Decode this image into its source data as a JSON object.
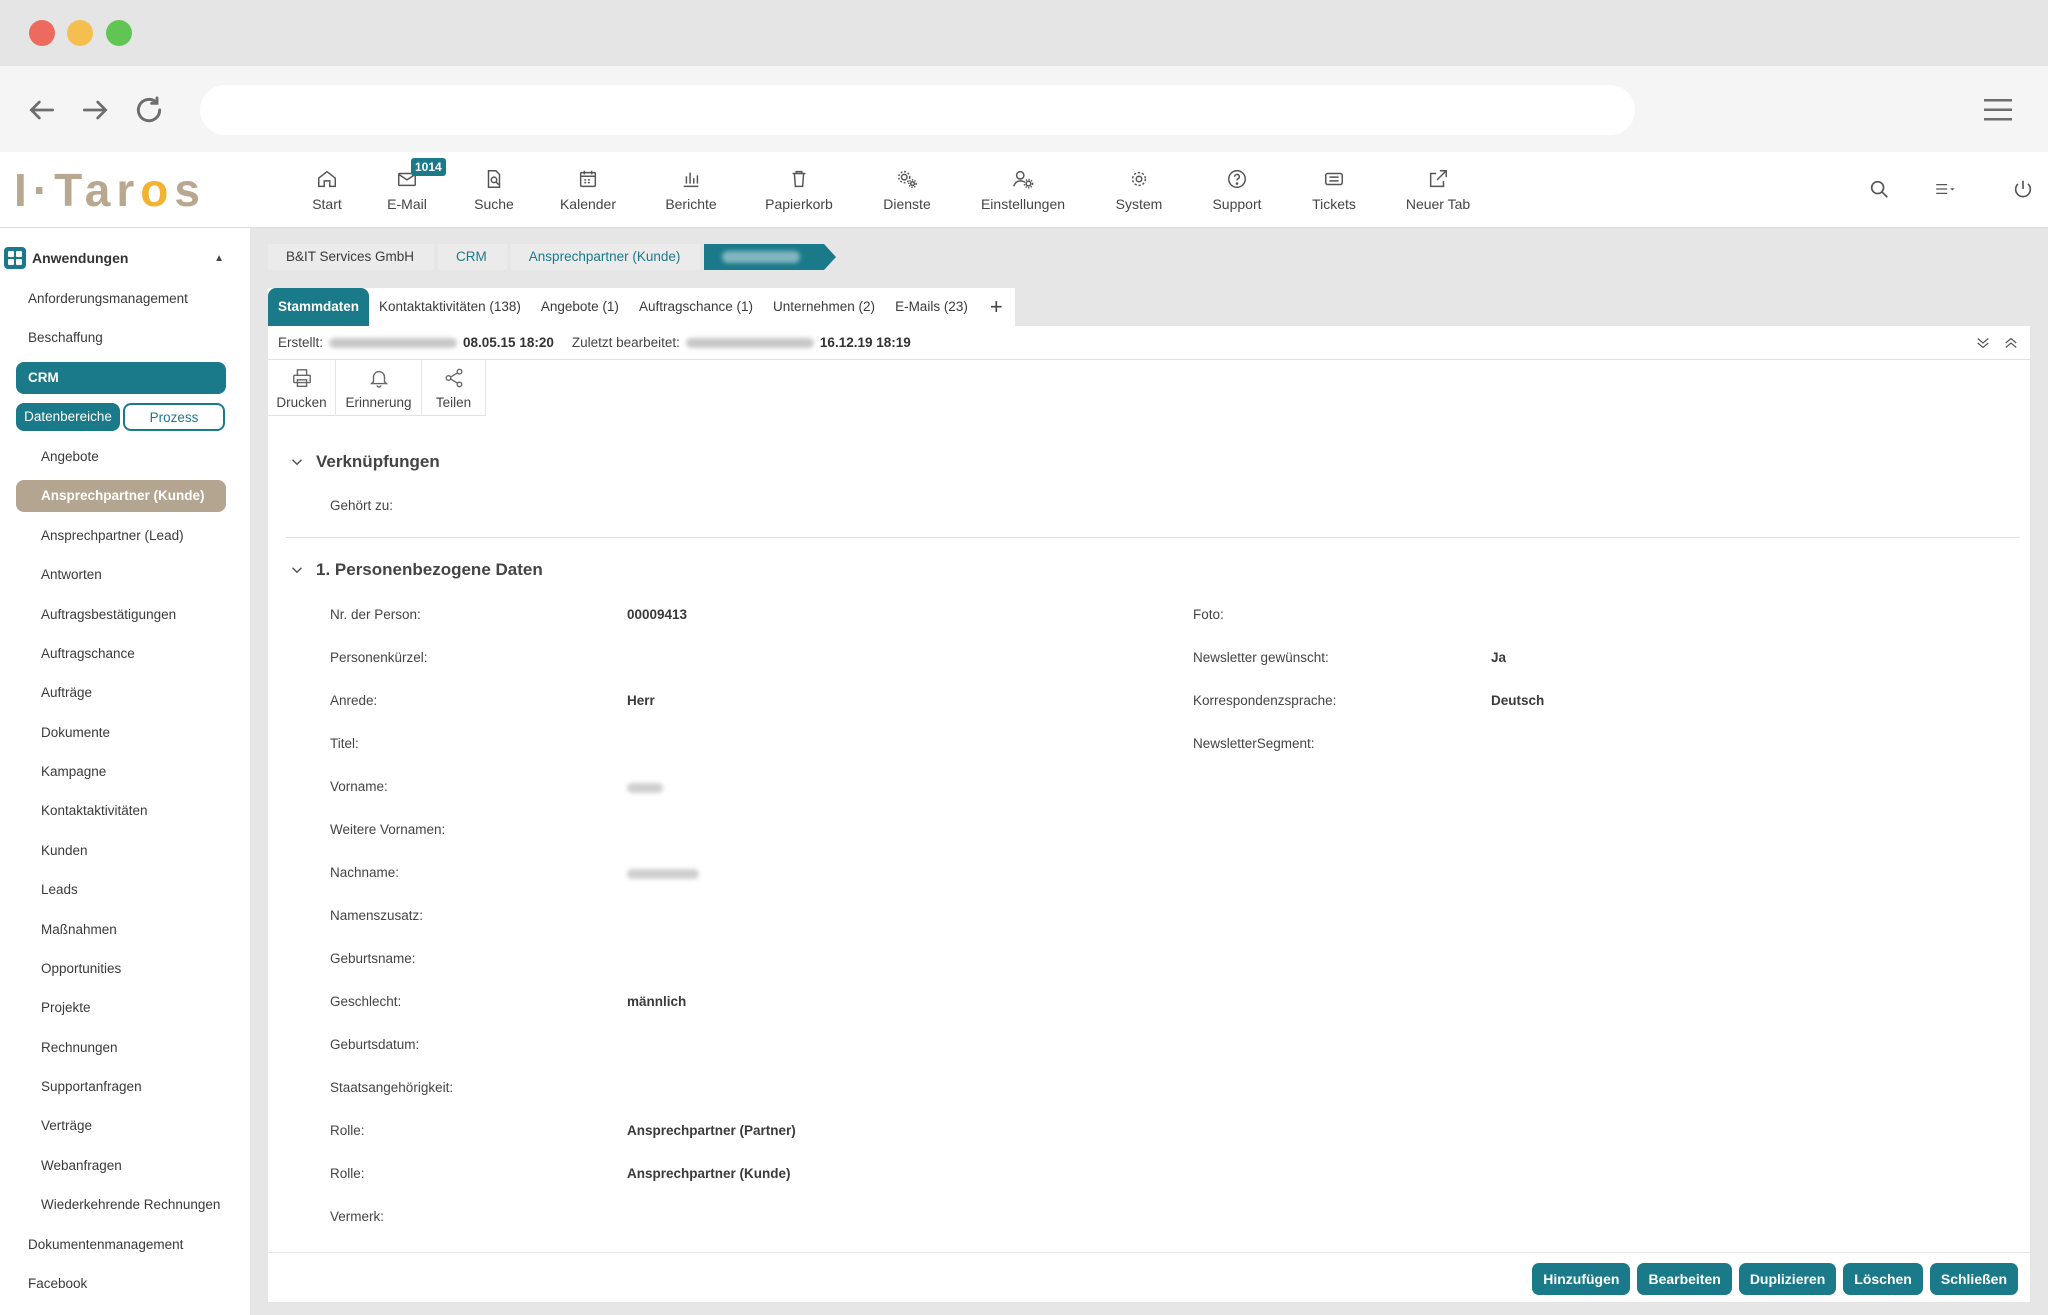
{
  "browser": {
    "icons": {
      "back": "arrow-left-icon",
      "forward": "arrow-right-icon",
      "reload": "reload-icon",
      "menu": "hamburger-icon"
    }
  },
  "app": {
    "logo_text_1": "I·Tar",
    "logo_text_2": "o",
    "logo_text_3": "s",
    "accent_color": "#1b7a8a",
    "toolbar": [
      {
        "label": "Start",
        "icon": "home-icon"
      },
      {
        "label": "E-Mail",
        "icon": "mail-icon",
        "badge": "1014"
      },
      {
        "label": "Suche",
        "icon": "search-doc-icon"
      },
      {
        "label": "Kalender",
        "icon": "calendar-icon"
      },
      {
        "label": "Berichte",
        "icon": "bar-chart-icon"
      },
      {
        "label": "Papierkorb",
        "icon": "trash-icon"
      },
      {
        "label": "Dienste",
        "icon": "gears-icon"
      },
      {
        "label": "Einstellungen",
        "icon": "user-gear-icon"
      },
      {
        "label": "System",
        "icon": "gear-icon"
      },
      {
        "label": "Support",
        "icon": "question-icon"
      },
      {
        "label": "Tickets",
        "icon": "ticket-icon"
      },
      {
        "label": "Neuer Tab",
        "icon": "external-link-icon"
      }
    ]
  },
  "sidebar": {
    "header": "Anwendungen",
    "items_top": [
      "Anforderungsmanagement",
      "Beschaffung"
    ],
    "crm": "CRM",
    "seg_on": "Datenbereiche",
    "seg_off": "Prozess",
    "sub_items": [
      "Angebote",
      "Ansprechpartner (Kunde)",
      "Ansprechpartner (Lead)",
      "Antworten",
      "Auftragsbestätigungen",
      "Auftragschance",
      "Aufträge",
      "Dokumente",
      "Kampagne",
      "Kontaktaktivitäten",
      "Kunden",
      "Leads",
      "Maßnahmen",
      "Opportunities",
      "Projekte",
      "Rechnungen",
      "Supportanfragen",
      "Verträge",
      "Webanfragen",
      "Wiederkehrende Rechnungen"
    ],
    "items_bottom": [
      "Dokumentenmanagement",
      "Facebook"
    ]
  },
  "breadcrumb": [
    "B&IT Services GmbH",
    "CRM",
    "Ansprechpartner (Kunde)"
  ],
  "tabs": [
    "Stammdaten",
    "Kontaktaktivitäten (138)",
    "Angebote (1)",
    "Auftragschance (1)",
    "Unternehmen (2)",
    "E-Mails (23)",
    "+"
  ],
  "info": {
    "created_label": "Erstellt:",
    "created_date": "08.05.15 18:20",
    "edited_label": "Zuletzt bearbeitet:",
    "edited_date": "16.12.19 18:19"
  },
  "actions": [
    "Drucken",
    "Erinnerung",
    "Teilen"
  ],
  "sections": {
    "links_title": "Verknüpfungen",
    "links_belongs": "Gehört zu:",
    "personal_title": "1. Personenbezogene Daten"
  },
  "fields_left": [
    {
      "label": "Nr. der Person:",
      "value": "00009413"
    },
    {
      "label": "Personenkürzel:",
      "value": ""
    },
    {
      "label": "Anrede:",
      "value": "Herr"
    },
    {
      "label": "Titel:",
      "value": ""
    },
    {
      "label": "Vorname:",
      "value": ""
    },
    {
      "label": "Weitere Vornamen:",
      "value": ""
    },
    {
      "label": "Nachname:",
      "value": ""
    },
    {
      "label": "Namenszusatz:",
      "value": ""
    },
    {
      "label": "Geburtsname:",
      "value": ""
    },
    {
      "label": "Geschlecht:",
      "value": "männlich"
    },
    {
      "label": "Geburtsdatum:",
      "value": ""
    },
    {
      "label": "Staatsangehörigkeit:",
      "value": ""
    },
    {
      "label": "Rolle:",
      "value": "Ansprechpartner (Partner)"
    },
    {
      "label": "Rolle:",
      "value": "Ansprechpartner (Kunde)"
    },
    {
      "label": "Vermerk:",
      "value": ""
    }
  ],
  "fields_right": [
    {
      "label": "Foto:",
      "value": ""
    },
    {
      "label": "Newsletter gewünscht:",
      "value": "Ja"
    },
    {
      "label": "Korrespondenzsprache:",
      "value": "Deutsch"
    },
    {
      "label": "NewsletterSegment:",
      "value": ""
    }
  ],
  "footer_buttons": [
    "Hinzufügen",
    "Bearbeiten",
    "Duplizieren",
    "Löschen",
    "Schließen"
  ]
}
